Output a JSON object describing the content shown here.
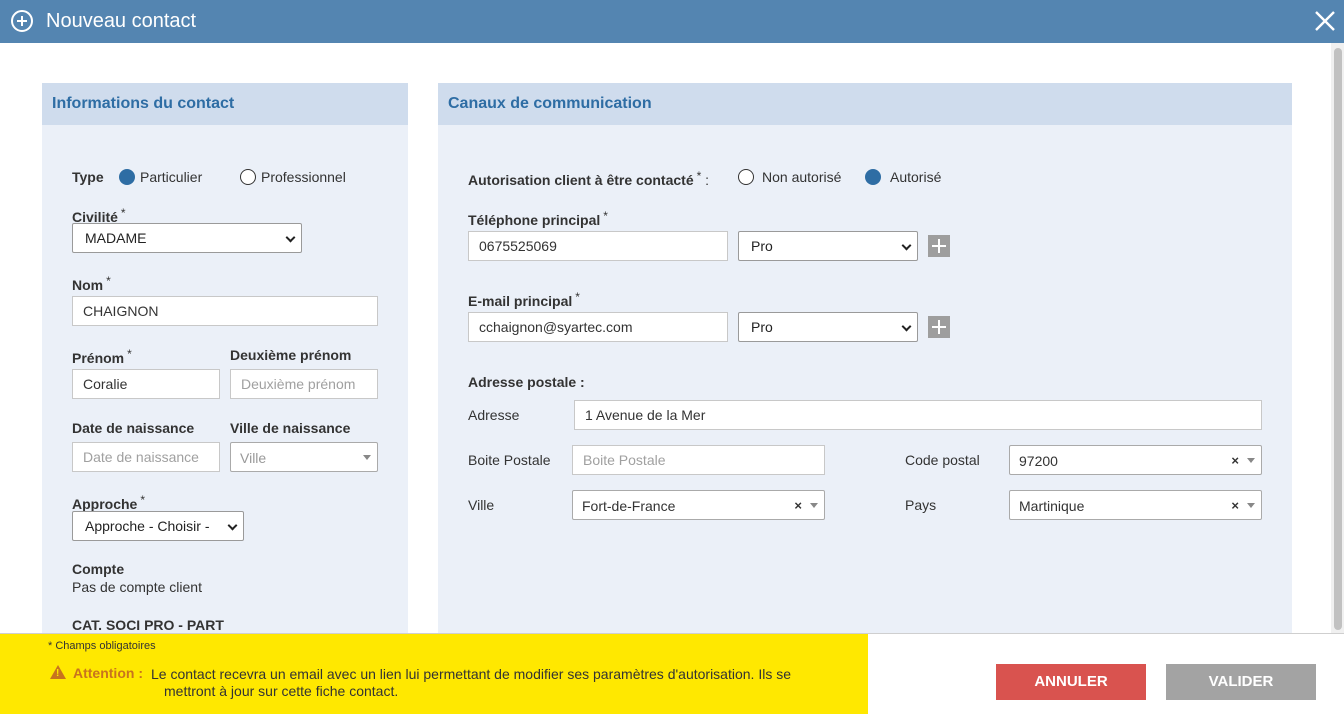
{
  "window": {
    "title": "Nouveau contact"
  },
  "left_panel": {
    "header": "Informations du contact",
    "type": {
      "label": "Type",
      "options": [
        "Particulier",
        "Professionnel"
      ],
      "selected": "Particulier"
    },
    "civilite": {
      "label": "Civilité",
      "value": "MADAME"
    },
    "nom": {
      "label": "Nom",
      "value": "CHAIGNON"
    },
    "prenom": {
      "label": "Prénom",
      "value": "Coralie"
    },
    "deuxieme_prenom": {
      "label": "Deuxième prénom",
      "placeholder": "Deuxième prénom"
    },
    "date_naissance": {
      "label": "Date de naissance",
      "placeholder": "Date de naissance"
    },
    "ville_naissance": {
      "label": "Ville de naissance",
      "placeholder": "Ville"
    },
    "approche": {
      "label": "Approche",
      "value": "Approche - Choisir -"
    },
    "compte": {
      "label": "Compte",
      "value": "Pas de compte client"
    },
    "cat_soci_pro": {
      "label": "CAT. SOCI PRO - PART"
    }
  },
  "right_panel": {
    "header": "Canaux de communication",
    "autorisation": {
      "label": "Autorisation client à être contacté",
      "suffix": ":",
      "options": [
        "Non autorisé",
        "Autorisé"
      ],
      "selected": "Autorisé"
    },
    "telephone": {
      "label": "Téléphone principal",
      "value": "0675525069",
      "type": "Pro"
    },
    "email": {
      "label": "E-mail principal",
      "value": "cchaignon@syartec.com",
      "type": "Pro"
    },
    "adresse_postale": {
      "label": "Adresse postale :",
      "adresse": {
        "label": "Adresse",
        "value": "1 Avenue de la Mer"
      },
      "boite_postale": {
        "label": "Boite Postale",
        "placeholder": "Boite Postale"
      },
      "code_postal": {
        "label": "Code postal",
        "value": "97200"
      },
      "ville": {
        "label": "Ville",
        "value": "Fort-de-France"
      },
      "pays": {
        "label": "Pays",
        "value": "Martinique"
      }
    }
  },
  "required_mark": "*",
  "footer": {
    "required_note": "* Champs obligatoires",
    "warning_label": "Attention :",
    "warning_line1": "Le contact recevra un email avec un lien lui permettant de modifier ses paramètres d'autorisation. Ils se",
    "warning_line2": "mettront à jour sur cette fiche contact.",
    "cancel_label": "ANNULER",
    "ok_label": "VALIDER"
  },
  "colors": {
    "titlebar": "#5485b1",
    "panel_header": "#cfdced",
    "panel_bg": "#ebf0f8",
    "accent": "#2e6da4",
    "warning_bg": "#ffe800",
    "cancel": "#d9534f",
    "ok": "#a3a3a3"
  },
  "clear_glyph": "×"
}
